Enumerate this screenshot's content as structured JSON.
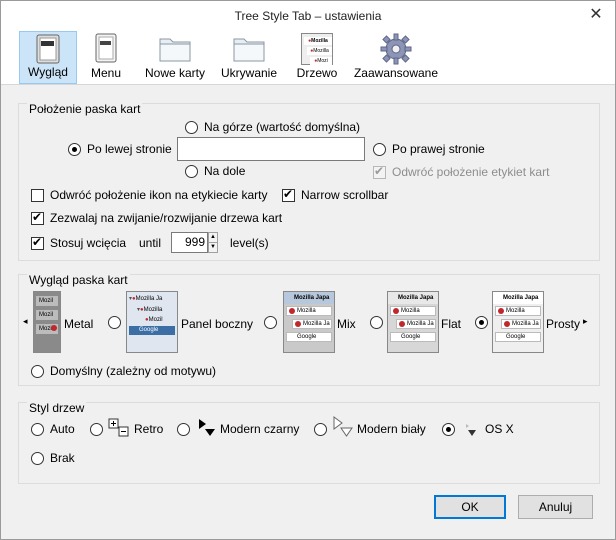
{
  "window": {
    "title": "Tree Style Tab – ustawienia",
    "close_glyph": "✕"
  },
  "toolbar": {
    "items": [
      {
        "label": "Wygląd",
        "icon": "appearance-icon",
        "selected": true
      },
      {
        "label": "Menu",
        "icon": "menu-icon"
      },
      {
        "label": "Nowe karty",
        "icon": "folder-icon"
      },
      {
        "label": "Ukrywanie",
        "icon": "folder-icon"
      },
      {
        "label": "Drzewo",
        "icon": "tree-icon"
      },
      {
        "label": "Zaawansowane",
        "icon": "gear-icon"
      }
    ],
    "tree_icon_rows": [
      "Mozilla",
      "Mozilla",
      "Mozi"
    ]
  },
  "position": {
    "title": "Położenie paska kart",
    "top": "Na górze (wartość domyślna)",
    "left": "Po lewej stronie",
    "right": "Po prawej stronie",
    "bottom": "Na dole",
    "invert_labels": "Odwróć położenie etykiet kart",
    "invert_icons": "Odwróć położenie ikon na etykiecie karty",
    "narrow_scrollbar": "Narrow scrollbar",
    "allow_collapse": "Zezwalaj na zwijanie/rozwijanie drzewa kart",
    "use_indent": "Stosuj wcięcia",
    "until": "until",
    "indent_value": "999",
    "levels": "level(s)"
  },
  "appearance": {
    "title": "Wygląd paska kart",
    "options": [
      "Metal",
      "Panel boczny",
      "Mix",
      "Flat",
      "Prosty"
    ],
    "default_option": "Domyślny (zależny od motywu)",
    "thumb_text": {
      "mozilla": "Mozilla",
      "mozilla_japa": "Mozilla Japa",
      "mozilla_ja": "Mozilla Ja",
      "mozil": "Mozil",
      "google": "Google"
    },
    "scroll_left": "◂",
    "scroll_right": "▸"
  },
  "tree_style": {
    "title": "Styl drzew",
    "options": [
      "Auto",
      "Retro",
      "Modern czarny",
      "Modern biały",
      "OS X",
      "Brak"
    ]
  },
  "buttons": {
    "ok": "OK",
    "cancel": "Anuluj"
  }
}
